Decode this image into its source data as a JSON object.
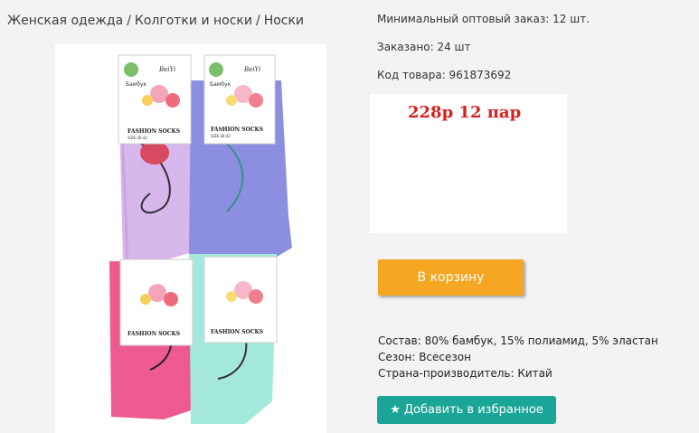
{
  "breadcrumb": {
    "items": [
      "Женская одежда",
      "Колготки и носки",
      "Носки"
    ],
    "separator": "/"
  },
  "product_info": {
    "min_order": "Минимальный оптовый заказ: 12 шт.",
    "ordered": "Заказано: 24 шт",
    "product_code": "Код товара: 961873692"
  },
  "price": {
    "text": "228р 12 пар",
    "color": "#d92020"
  },
  "cart_button": {
    "label": "В корзину",
    "color": "#f5a623"
  },
  "specs": {
    "composition": "Состав: 80% бамбук, 15% полиамид, 5% эластан",
    "season": "Сезон: Всесезон",
    "country": "Страна-производитель: Китай"
  },
  "favorite_button": {
    "label": "Добавить в избранное",
    "icon": "star-icon",
    "color": "#1aa596"
  },
  "product_image": {
    "label_brand": "Бамбук",
    "label_logo": "BeiYi",
    "label_title": "FASHION SOCKS",
    "label_size": "SIZE:36-42"
  }
}
